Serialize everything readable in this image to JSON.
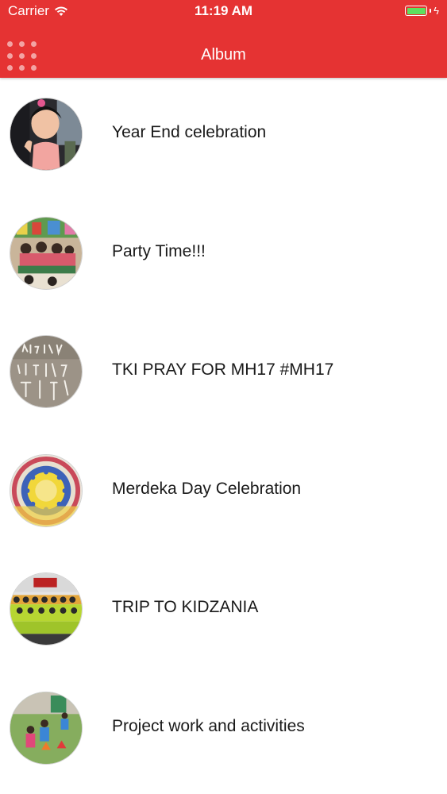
{
  "theme": {
    "accent": "#e53333"
  },
  "status_bar": {
    "carrier": "Carrier",
    "time": "11:19 AM",
    "wifi_icon": "wifi-icon",
    "battery_icon": "battery-icon",
    "charging_icon": "bolt-icon",
    "charging_glyph": "ϟ"
  },
  "nav_bar": {
    "title": "Album",
    "menu_icon": "grid-menu-icon"
  },
  "albums": [
    {
      "label": "Year End celebration"
    },
    {
      "label": "Party Time!!!"
    },
    {
      "label": "TKI PRAY FOR MH17 #MH17"
    },
    {
      "label": "Merdeka Day Celebration"
    },
    {
      "label": "TRIP TO KIDZANIA"
    },
    {
      "label": "Project work and activities"
    }
  ]
}
